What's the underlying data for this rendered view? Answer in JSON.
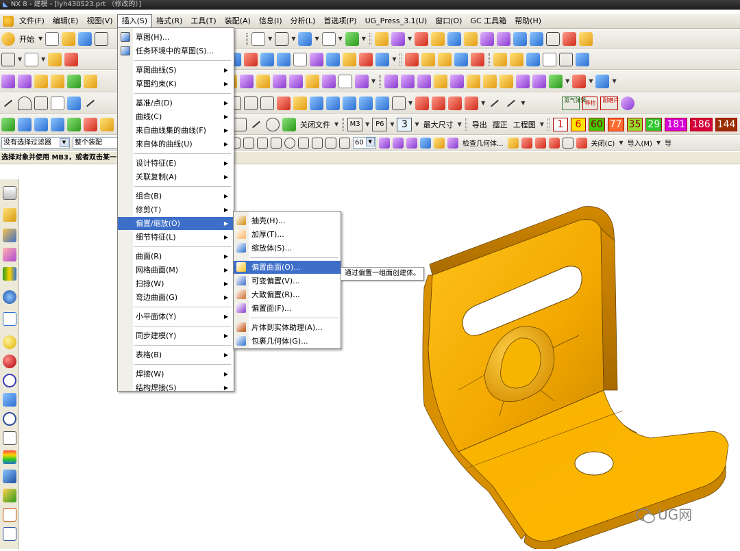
{
  "window": {
    "title": "NX 8 - 建模 - [lyh430523.prt （修改的）]"
  },
  "menubar": {
    "items": [
      "文件(F)",
      "编辑(E)",
      "视图(V)",
      "插入(S)",
      "格式(R)",
      "工具(T)",
      "装配(A)",
      "信息(I)",
      "分析(L)",
      "首选项(P)",
      "UG_Press_3.1(U)",
      "窗口(O)",
      "GC 工具箱",
      "帮助(H)"
    ],
    "active": "插入(S)"
  },
  "toolbar1": {
    "start_label": "开始"
  },
  "toolbar5": {
    "close_file_label": "关闭文件",
    "m3_label": "M3",
    "p6_label": "P6",
    "three_label": "3",
    "max_size_label": "最大尺寸",
    "export_label": "导出",
    "straighten_label": "摆正",
    "drawing_label": "工程图",
    "numbers": [
      {
        "text": "1",
        "bg": "#ffffff",
        "fg": "#d40000"
      },
      {
        "text": "6",
        "bg": "#ffe400",
        "fg": "#d40000"
      },
      {
        "text": "60",
        "bg": "#45c800",
        "fg": "#7a0000"
      },
      {
        "text": "77",
        "bg": "#ff6a2e",
        "fg": "#ffffff"
      },
      {
        "text": "35",
        "bg": "#9adc2e",
        "fg": "#7a0000"
      },
      {
        "text": "29",
        "bg": "#2ec82e",
        "fg": "#ffffff"
      },
      {
        "text": "181",
        "bg": "#d400d4",
        "fg": "#ffffff"
      },
      {
        "text": "186",
        "bg": "#d4003a",
        "fg": "#ffffff"
      },
      {
        "text": "144",
        "bg": "#9a2e00",
        "fg": "#ffffff"
      }
    ],
    "side_labels": [
      "氮气弹簧",
      "导柱",
      "耐磨片"
    ]
  },
  "selectionbar": {
    "filter_value": "没有选择过滤器",
    "scope_value": "整个装配",
    "number_value": "60",
    "check_geometry_label": "检查几何体...",
    "close_label": "关闭(C)",
    "import_label": "导入(M)",
    "import2_label": "导"
  },
  "status": {
    "text": "选择对象并使用 MB3，或者双击某一"
  },
  "insert_menu": {
    "items": [
      {
        "label": "草图(H)...",
        "arrow": false
      },
      {
        "label": "任务环境中的草图(S)...",
        "arrow": false
      },
      {
        "label": "草图曲线(S)",
        "arrow": true
      },
      {
        "label": "草图约束(K)",
        "arrow": true
      },
      {
        "label": "基准/点(D)",
        "arrow": true
      },
      {
        "label": "曲线(C)",
        "arrow": true
      },
      {
        "label": "来自曲线集的曲线(F)",
        "arrow": true
      },
      {
        "label": "来自体的曲线(U)",
        "arrow": true
      },
      {
        "label": "设计特征(E)",
        "arrow": true
      },
      {
        "label": "关联复制(A)",
        "arrow": true
      },
      {
        "label": "组合(B)",
        "arrow": true
      },
      {
        "label": "修剪(T)",
        "arrow": true
      },
      {
        "label": "偏置/缩放(O)",
        "arrow": true
      },
      {
        "label": "细节特征(L)",
        "arrow": true
      },
      {
        "label": "曲面(R)",
        "arrow": true
      },
      {
        "label": "网格曲面(M)",
        "arrow": true
      },
      {
        "label": "扫掠(W)",
        "arrow": true
      },
      {
        "label": "弯边曲面(G)",
        "arrow": true
      },
      {
        "label": "小平面体(Y)",
        "arrow": true
      },
      {
        "label": "同步建模(Y)",
        "arrow": true
      },
      {
        "label": "表格(B)",
        "arrow": true
      },
      {
        "label": "焊接(W)",
        "arrow": true
      },
      {
        "label": "结构焊接(S)",
        "arrow": true
      }
    ]
  },
  "offset_submenu": {
    "items": [
      {
        "label": "抽壳(H)..."
      },
      {
        "label": "加厚(T)..."
      },
      {
        "label": "缩放体(S)..."
      },
      {
        "label": "偏置曲面(O)..."
      },
      {
        "label": "可变偏置(V)..."
      },
      {
        "label": "大致偏置(R)..."
      },
      {
        "label": "偏置面(F)..."
      },
      {
        "label": "片体到实体助理(A)..."
      },
      {
        "label": "包裹几何体(G)..."
      }
    ],
    "highlighted": "偏置曲面(O)..."
  },
  "tooltip": {
    "text": "通过偏置一组面创建体。"
  },
  "watermark": {
    "text": "UG网"
  },
  "colors": {
    "part": "#f2ad00",
    "part_shadow": "#b87400",
    "highlight": "#3d6fc9"
  }
}
